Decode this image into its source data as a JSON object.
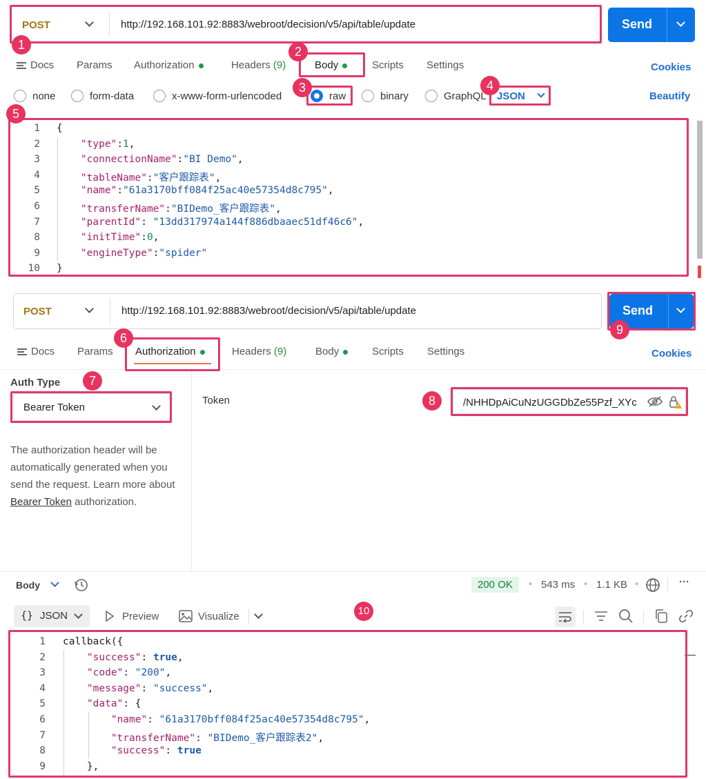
{
  "request1": {
    "method": "POST",
    "url": "http://192.168.101.92:8883/webroot/decision/v5/api/table/update",
    "send_label": "Send"
  },
  "tabs1": {
    "docs": "Docs",
    "params": "Params",
    "authorization": "Authorization",
    "headers": "Headers",
    "headers_count": "(9)",
    "body": "Body",
    "scripts": "Scripts",
    "settings": "Settings",
    "cookies": "Cookies"
  },
  "body_types": {
    "none": "none",
    "form_data": "form-data",
    "urlencoded": "x-www-form-urlencoded",
    "raw": "raw",
    "binary": "binary",
    "graphql": "GraphQL",
    "format": "JSON",
    "beautify": "Beautify"
  },
  "request_body": {
    "line_numbers": [
      "1",
      "2",
      "3",
      "4",
      "5",
      "6",
      "7",
      "8",
      "9",
      "10"
    ],
    "lines": [
      {
        "indent": "",
        "key": "",
        "value": "",
        "punct": "{"
      },
      {
        "indent": "    ",
        "key": "\"type\"",
        "sep": ":",
        "value": "1",
        "vtype": "n",
        "punct": ","
      },
      {
        "indent": "    ",
        "key": "\"connectionName\"",
        "sep": ":",
        "value": "\"BI Demo\"",
        "vtype": "s",
        "punct": ","
      },
      {
        "indent": "    ",
        "key": "\"tableName\"",
        "sep": ":",
        "value": "\"客户跟踪表\"",
        "vtype": "s",
        "punct": ","
      },
      {
        "indent": "    ",
        "key": "\"name\"",
        "sep": ":",
        "value": "\"61a3170bff084f25ac40e57354d8c795\"",
        "vtype": "s",
        "punct": ","
      },
      {
        "indent": "    ",
        "key": "\"transferName\"",
        "sep": ":",
        "value": "\"BIDemo_客户跟踪表\"",
        "vtype": "s",
        "punct": ","
      },
      {
        "indent": "    ",
        "key": "\"parentId\"",
        "sep": ": ",
        "value": "\"13dd317974a144f886dbaaec51df46c6\"",
        "vtype": "s",
        "punct": ","
      },
      {
        "indent": "    ",
        "key": "\"initTime\"",
        "sep": ":",
        "value": "0",
        "vtype": "n",
        "punct": ","
      },
      {
        "indent": "    ",
        "key": "\"engineType\"",
        "sep": ":",
        "value": "\"spider\"",
        "vtype": "s",
        "punct": ""
      },
      {
        "indent": "",
        "key": "",
        "value": "",
        "punct": "}"
      }
    ]
  },
  "request2": {
    "method": "POST",
    "url": "http://192.168.101.92:8883/webroot/decision/v5/api/table/update",
    "send_label": "Send"
  },
  "tabs2": {
    "docs": "Docs",
    "params": "Params",
    "authorization": "Authorization",
    "headers": "Headers",
    "headers_count": "(9)",
    "body": "Body",
    "scripts": "Scripts",
    "settings": "Settings",
    "cookies": "Cookies"
  },
  "auth": {
    "type_label": "Auth Type",
    "type_value": "Bearer Token",
    "description_1": "The authorization header will be automatically generated when you send the request. Learn more about ",
    "description_link": "Bearer Token",
    "description_2": " authorization.",
    "token_label": "Token",
    "token_value": "/NHHDpAiCuNzUGGDbZe55Pzf_XYc"
  },
  "response": {
    "body_label": "Body",
    "status": "200 OK",
    "time": "543 ms",
    "size": "1.1 KB",
    "format": "JSON",
    "preview": "Preview",
    "visualize": "Visualize",
    "line_numbers": [
      "1",
      "2",
      "3",
      "4",
      "5",
      "6",
      "7",
      "8",
      "9"
    ],
    "lines": [
      {
        "text": "callback({"
      },
      {
        "indent": "    ",
        "key": "\"success\"",
        "value": "true",
        "vtype": "b",
        "punct": ","
      },
      {
        "indent": "    ",
        "key": "\"code\"",
        "value": "\"200\"",
        "vtype": "s",
        "punct": ","
      },
      {
        "indent": "    ",
        "key": "\"message\"",
        "value": "\"success\"",
        "vtype": "s",
        "punct": ","
      },
      {
        "indent": "    ",
        "key": "\"data\"",
        "value": "{",
        "vtype": "p",
        "punct": ""
      },
      {
        "indent": "        ",
        "key": "\"name\"",
        "value": "\"61a3170bff084f25ac40e57354d8c795\"",
        "vtype": "s",
        "punct": ","
      },
      {
        "indent": "        ",
        "key": "\"transferName\"",
        "value": "\"BIDemo_客户跟踪表2\"",
        "vtype": "s",
        "punct": ","
      },
      {
        "indent": "        ",
        "key": "\"success\"",
        "value": "true",
        "vtype": "b",
        "punct": ""
      },
      {
        "indent": "    ",
        "text": "},"
      }
    ]
  },
  "badges": [
    "1",
    "2",
    "3",
    "4",
    "5",
    "6",
    "7",
    "8",
    "9",
    "10"
  ],
  "colors": {
    "accent": "#0c75e6",
    "highlight": "#e0386a",
    "method": "#a57417",
    "ok": "#157f3c"
  }
}
